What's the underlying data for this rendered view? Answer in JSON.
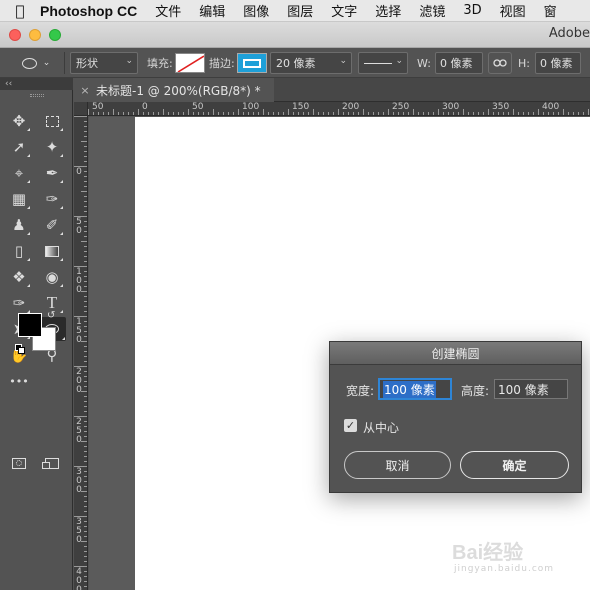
{
  "menubar": {
    "app": "Photoshop CC",
    "items": [
      "文件",
      "编辑",
      "图像",
      "图层",
      "文字",
      "选择",
      "滤镜",
      "3D",
      "视图",
      "窗"
    ]
  },
  "window": {
    "title": "Adobe"
  },
  "options_bar": {
    "mode": "形状",
    "fill_label": "填充:",
    "stroke_label": "描边:",
    "stroke_width": "20 像素",
    "w_label": "W:",
    "w_value": "0 像素",
    "h_label": "H:",
    "h_value": "0 像素"
  },
  "toolbar": {
    "collapse": "‹‹",
    "more": "•••"
  },
  "document": {
    "tab_title": "未标题-1 @ 200%(RGB/8*) *",
    "close": "×",
    "h_ruler": [
      "50",
      "0",
      "50",
      "100",
      "150",
      "200",
      "250",
      "300",
      "350",
      "400",
      "450"
    ],
    "v_ruler": [
      "0",
      "5\n0",
      "1\n0\n0",
      "1\n5\n0",
      "2\n0\n0",
      "2\n5\n0",
      "3\n0\n0",
      "3\n5\n0",
      "4\n0\n0"
    ]
  },
  "dialog": {
    "title": "创建椭圆",
    "width_label": "宽度:",
    "width_value": "100 像素",
    "height_label": "高度:",
    "height_value": "100 像素",
    "from_center_label": "从中心",
    "from_center_checked": true,
    "cancel": "取消",
    "ok": "确定"
  },
  "watermark": {
    "text": "Bai经验",
    "url": "jingyan.baidu.com"
  }
}
